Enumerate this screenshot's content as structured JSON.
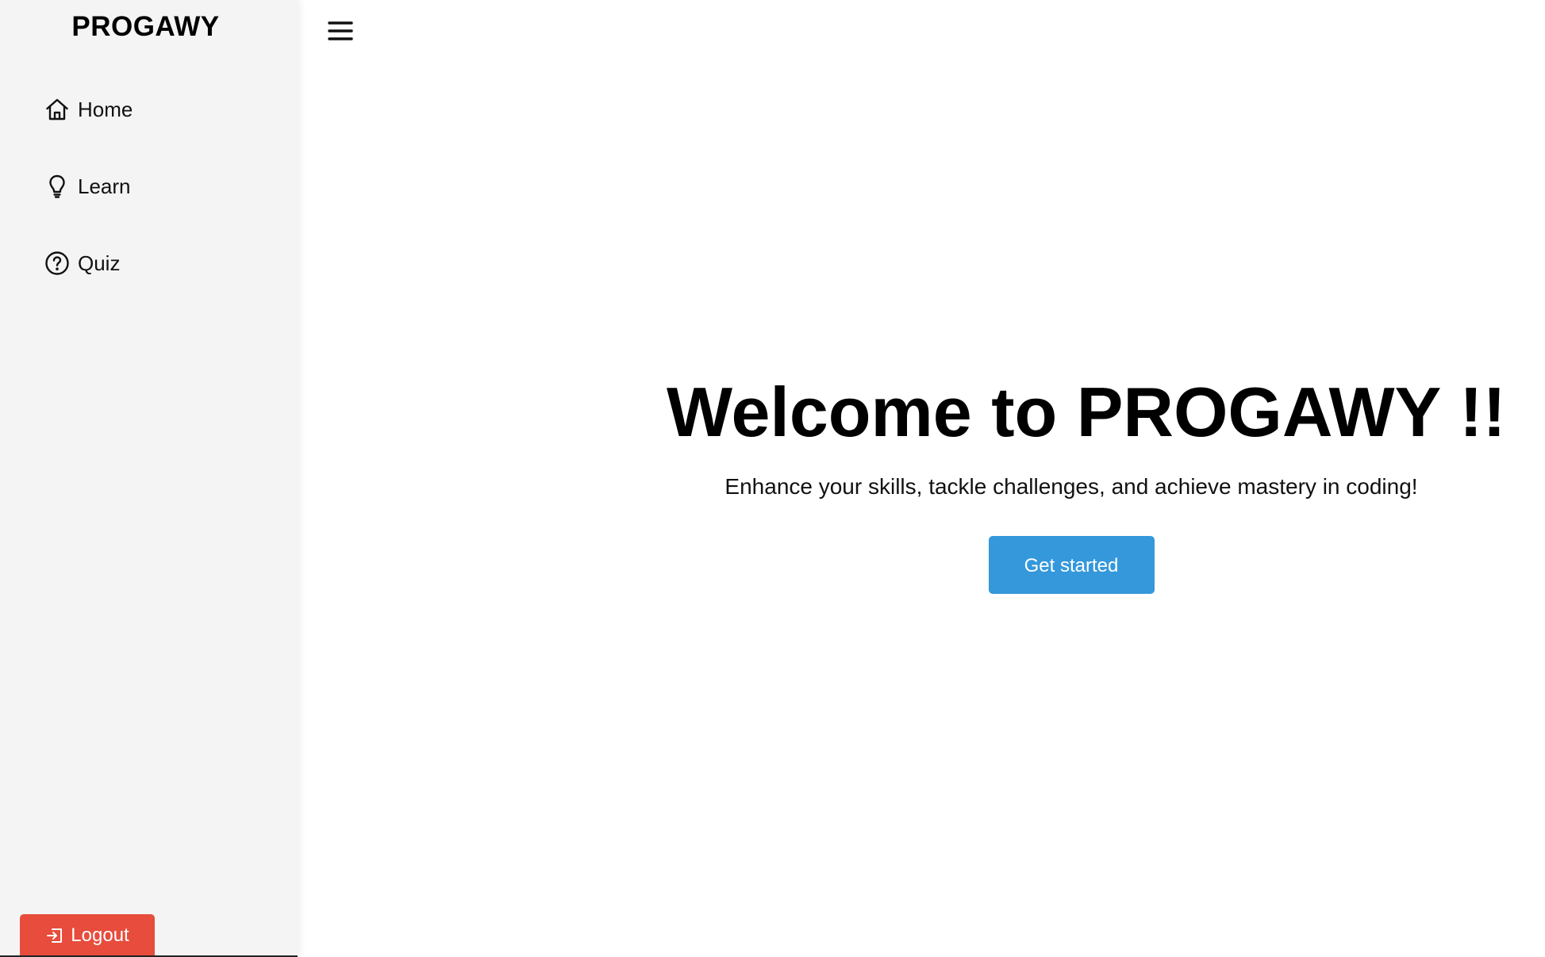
{
  "sidebar": {
    "brand": "PROGAWY",
    "items": [
      {
        "label": "Home",
        "icon": "home-icon"
      },
      {
        "label": "Learn",
        "icon": "lightbulb-icon"
      },
      {
        "label": "Quiz",
        "icon": "question-circle-icon"
      }
    ],
    "logout": {
      "label": "Logout",
      "icon": "logout-icon",
      "color": "#e74c3c"
    }
  },
  "header": {
    "menu_icon": "hamburger-menu-icon"
  },
  "main": {
    "title": "Welcome to PROGAWY !!",
    "subtitle": "Enhance your skills, tackle challenges, and achieve mastery in coding!",
    "cta_label": "Get started",
    "cta_color": "#3498db"
  },
  "colors": {
    "sidebar_bg": "#f4f4f4",
    "page_bg": "#ffffff"
  }
}
